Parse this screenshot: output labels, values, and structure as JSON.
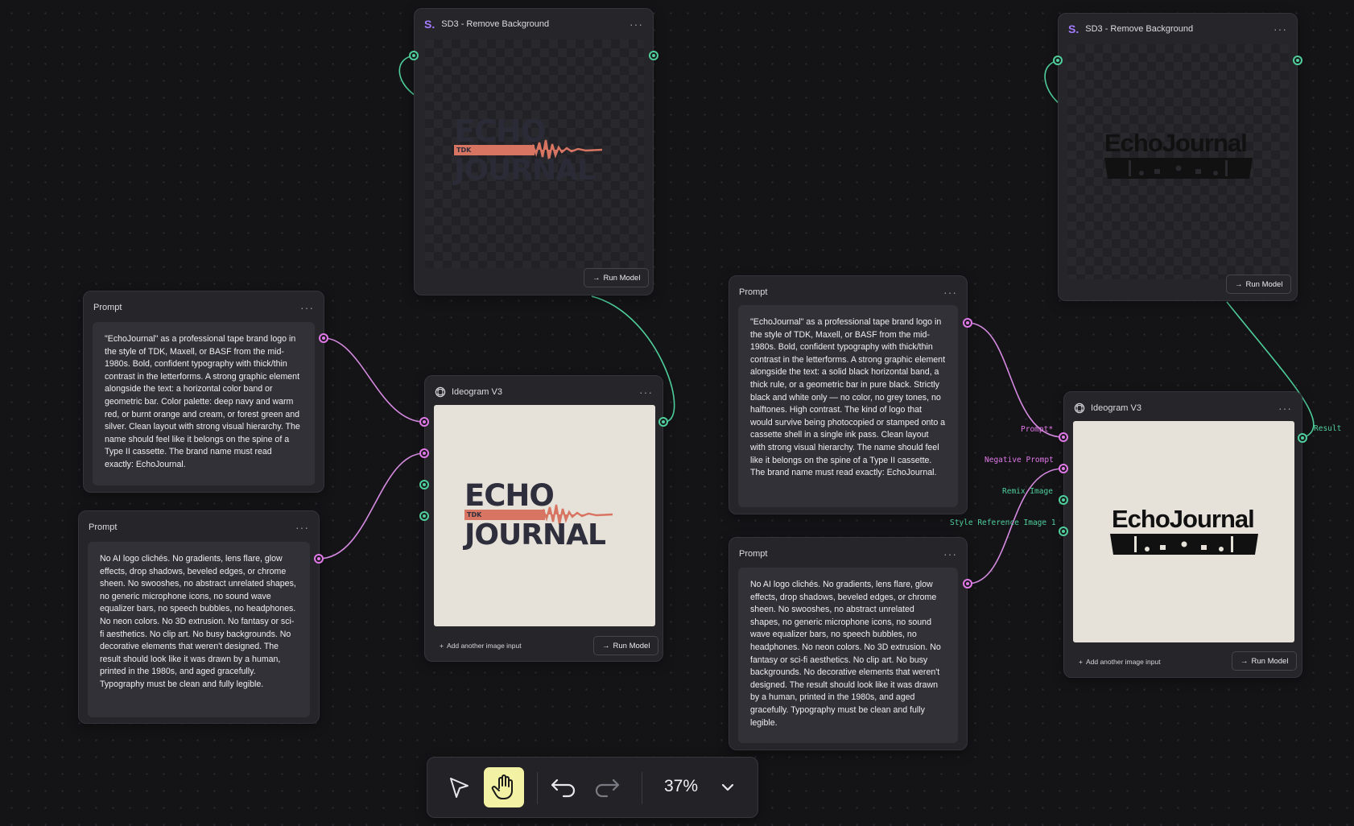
{
  "prompt_node_title": "Prompt",
  "more_glyph": "···",
  "prompt_positive_1": "\"EchoJournal\" as a professional tape brand logo in the style of TDK, Maxell, or BASF from the mid-1980s. Bold, confident typography with thick/thin contrast in the letterforms. A strong graphic element alongside the text: a horizontal color band or geometric bar. Color palette: deep navy and warm red, or burnt orange and cream, or forest green and silver. Clean layout with strong visual hierarchy. The name should feel like it belongs on the spine of a Type II cassette. The brand name must read exactly: EchoJournal.",
  "prompt_negative": "No AI logo clichés. No gradients, lens flare, glow effects, drop shadows, beveled edges, or chrome sheen. No swooshes, no abstract unrelated shapes, no generic microphone icons, no sound wave equalizer bars, no speech bubbles, no headphones. No neon colors. No 3D extrusion. No fantasy or sci-fi aesthetics. No clip art. No busy backgrounds. No decorative elements that weren't designed. The result should look like it was drawn by a human, printed in the 1980s, and aged gracefully. Typography must be clean and fully legible.",
  "prompt_positive_2": "\"EchoJournal\" as a professional tape brand logo in the style of TDK, Maxell, or BASF from the mid-1980s. Bold, confident typography with thick/thin contrast in the letterforms. A strong graphic element alongside the text: a solid black horizontal band, a thick rule, or a geometric bar in pure black. Strictly black and white only — no color, no grey tones, no halftones. High contrast. The kind of logo that would survive being photocopied or stamped onto a cassette shell in a single ink pass. Clean layout with strong visual hierarchy. The name should feel like it belongs on the spine of a Type II cassette. The brand name must read exactly: EchoJournal.",
  "sd3_title": "SD3 - Remove Background",
  "sd3_logo": "S.",
  "ideogram_title": "Ideogram V3",
  "run_model": "Run Model",
  "add_image_input": "Add another image input",
  "ports": {
    "prompt": "Prompt*",
    "negative": "Negative Prompt",
    "remix": "Remix Image",
    "style": "Style Reference Image 1",
    "result": "Result"
  },
  "logo1": {
    "echo": "ECHO",
    "journal": "JOURNAL",
    "tdk": "TDK"
  },
  "logo2": {
    "word": "EchoJournal"
  },
  "toolbar": {
    "zoom": "37%"
  },
  "colors": {
    "accent_green": "#4fcf9c",
    "accent_pink": "#e078e8",
    "active_tool": "#f3f2a4",
    "logo_red": "#d87462",
    "logo_navy": "#2e2e3c"
  }
}
